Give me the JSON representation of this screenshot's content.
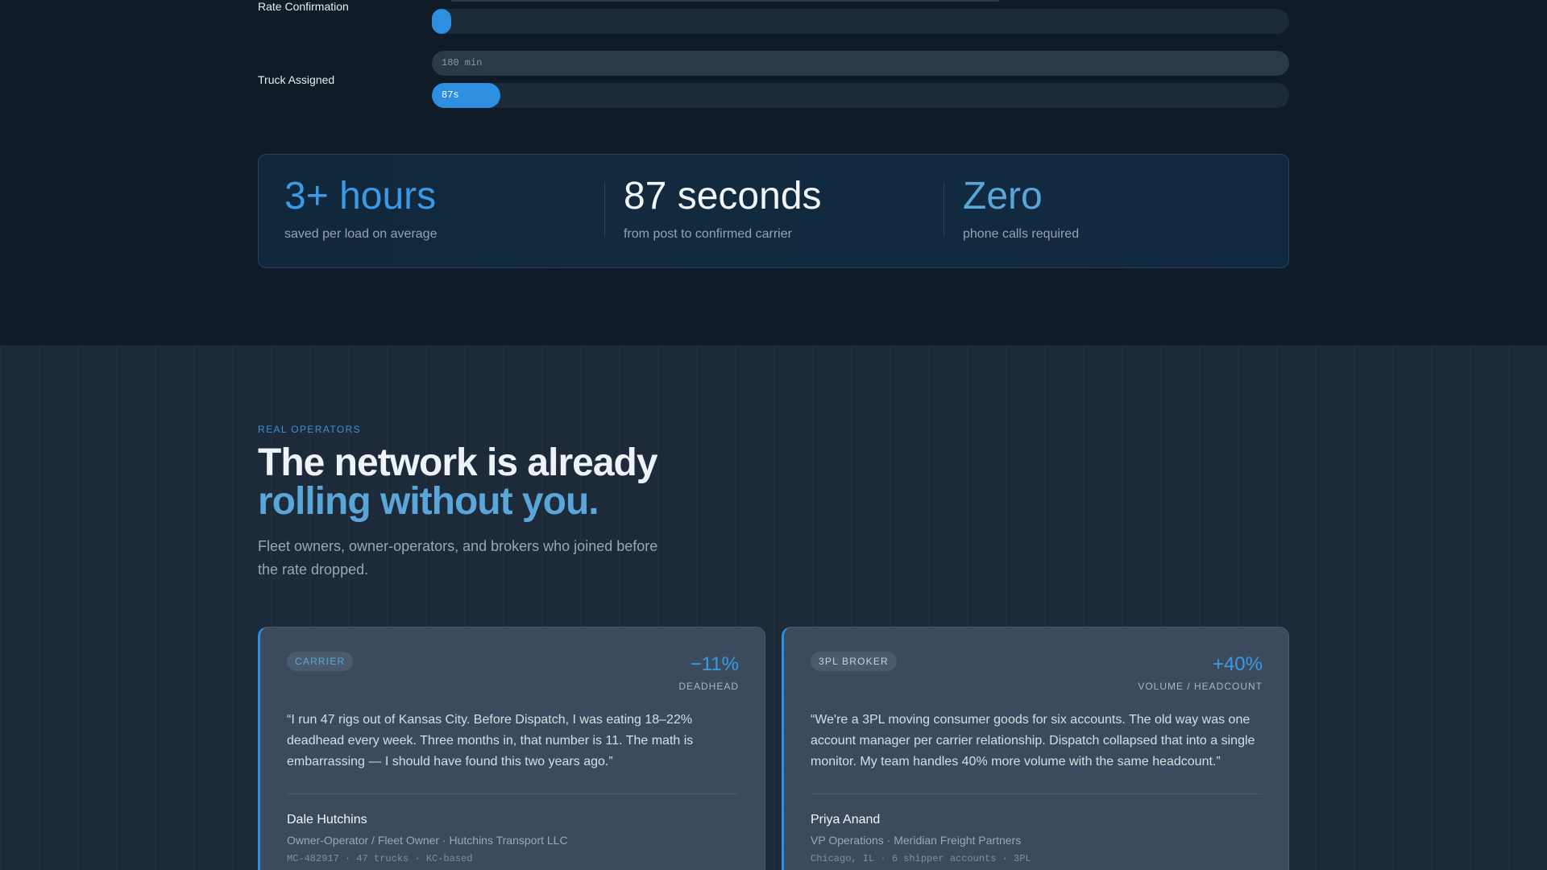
{
  "comparison": {
    "rows": [
      {
        "label": "Rate Confirmation",
        "bar_before_text": "",
        "bar_after_text": ""
      },
      {
        "label": "Truck Assigned",
        "bar_before_text": "180 min",
        "bar_after_text": "87s"
      }
    ]
  },
  "stats": [
    {
      "value": "3+ hours",
      "sub": "saved per load on average",
      "color": "#3b99e6"
    },
    {
      "value": "87 seconds",
      "sub": "from post to confirmed carrier",
      "color": "#f1f5f8"
    },
    {
      "value": "Zero",
      "sub": "phone calls required",
      "color": "#5aa6d8"
    }
  ],
  "section": {
    "eyebrow": "REAL OPERATORS",
    "headline_line1": "The network is already",
    "headline_line2": "rolling without you.",
    "lede": "Fleet owners, owner-operators, and brokers who joined before the rate dropped."
  },
  "testimonials": [
    {
      "tag": "CARRIER",
      "metric_value": "−11%",
      "metric_label": "DEADHEAD",
      "quote": "“I run 47 rigs out of Kansas City. Before Dispatch, I was eating 18–22% deadhead every week. Three months in, that number is 11. The math is embarrassing — I should have found this two years ago.”",
      "name": "Dale Hutchins",
      "role": "Owner-Operator / Fleet Owner · Hutchins Transport LLC",
      "meta": "MC-482917 · 47 trucks · KC-based"
    },
    {
      "tag": "3PL BROKER",
      "metric_value": "+40%",
      "metric_label": "VOLUME / HEADCOUNT",
      "quote": "“We're a 3PL moving consumer goods for six accounts. The old way was one account manager per carrier relationship. Dispatch collapsed that into a single monitor. My team handles 40% more volume with the same headcount.”",
      "name": "Priya Anand",
      "role": "VP Operations · Meridian Freight Partners",
      "meta": "Chicago, IL · 6 shipper accounts · 3PL"
    }
  ]
}
